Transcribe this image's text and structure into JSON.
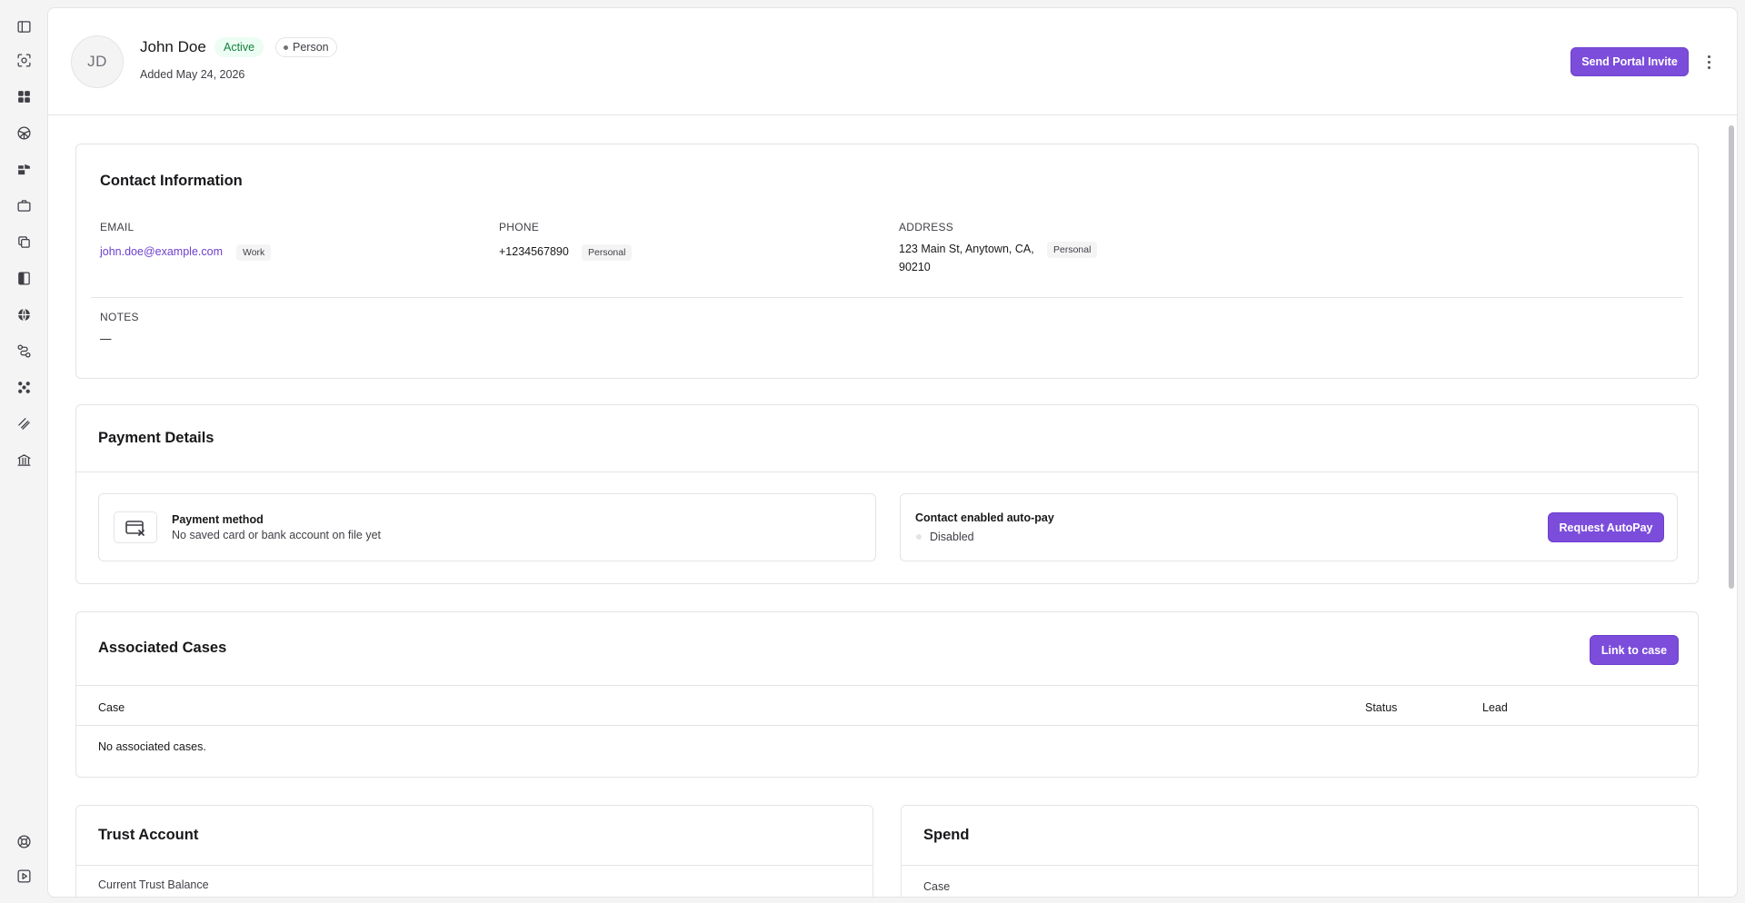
{
  "sidebar": {
    "icons": [
      "panel-toggle-icon",
      "scan-face-icon",
      "dashboard-icon",
      "globe-icon",
      "layers-icon",
      "briefcase-icon",
      "copy-icon",
      "book-icon",
      "world-icon",
      "route-icon",
      "contacts-icon",
      "ruler-icon",
      "bank-icon"
    ],
    "bottom_icons": [
      "help-icon",
      "play-icon"
    ]
  },
  "contact": {
    "initials": "JD",
    "name": "John Doe",
    "status": "Active",
    "type": "Person",
    "added": "Added May 24, 2026",
    "invite_label": "Send Portal Invite"
  },
  "contact_info": {
    "title": "Contact Information",
    "email_label": "EMAIL",
    "email": "john.doe@example.com",
    "email_tag": "Work",
    "phone_label": "PHONE",
    "phone": "+1234567890",
    "phone_tag": "Personal",
    "address_label": "ADDRESS",
    "address_line1": "123 Main St, Anytown, CA,",
    "address_line2": "90210",
    "address_tag": "Personal",
    "notes_label": "NOTES",
    "notes": "—"
  },
  "payment": {
    "title": "Payment Details",
    "method_label": "Payment method",
    "method_desc": "No saved card or bank account on file yet",
    "autopay_label": "Contact enabled auto-pay",
    "autopay_status": "Disabled",
    "request_label": "Request AutoPay"
  },
  "cases": {
    "title": "Associated Cases",
    "link_label": "Link to case",
    "columns": [
      "Case",
      "Status",
      "Lead"
    ],
    "empty": "No associated cases."
  },
  "trust": {
    "title": "Trust Account",
    "balance_label": "Current Trust Balance"
  },
  "spend": {
    "title": "Spend",
    "case_label": "Case"
  },
  "colors": {
    "accent": "#7c4ddb",
    "active_bg": "#ecfdf3",
    "active_text": "#15803d"
  }
}
